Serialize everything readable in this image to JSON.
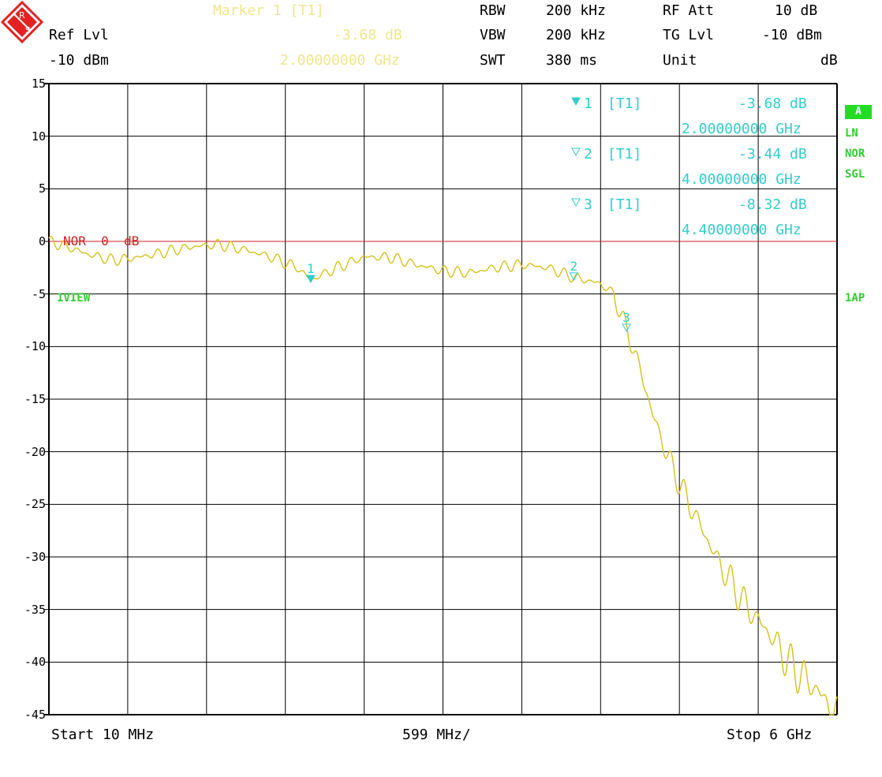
{
  "header": {
    "marker_title": "Marker 1 [T1]",
    "ref_lvl_label": "Ref Lvl",
    "ref_lvl_value": "-10 dBm",
    "marker_level": "-3.68 dB",
    "marker_freq": "2.00000000 GHz",
    "rbw_label": "RBW",
    "rbw_value": "200 kHz",
    "vbw_label": "VBW",
    "vbw_value": "200 kHz",
    "swt_label": "SWT",
    "swt_value": "380 ms",
    "rf_att_label": "RF Att",
    "rf_att_value": "10 dB",
    "tg_lvl_label": "TG Lvl",
    "tg_lvl_value": "-10 dBm",
    "unit_label": "Unit",
    "unit_value": "dB"
  },
  "markers": [
    {
      "label": "1",
      "tag": "[T1]",
      "level": "-3.68 dB",
      "freq": "2.00000000 GHz"
    },
    {
      "label": "2",
      "tag": "[T1]",
      "level": "-3.44 dB",
      "freq": "4.00000000 GHz"
    },
    {
      "label": "3",
      "tag": "[T1]",
      "level": "-8.32 dB",
      "freq": "4.40000000 GHz"
    }
  ],
  "side_labels": {
    "a": "A",
    "ln": "LN",
    "nor": "NOR",
    "sgl": "SGL",
    "ap": "1AP",
    "view": "1VIEW"
  },
  "ref_line_label": "NOR  0  dB",
  "footer": {
    "start": "Start 10 MHz",
    "div": "599 MHz/",
    "stop": "Stop 6 GHz"
  },
  "colors": {
    "trace": "#d4c21a",
    "marker": "#33cccc",
    "ref_line": "#cc2222",
    "annotation": "#f0e68c",
    "grid": "#000000"
  },
  "chart_data": {
    "type": "line",
    "xlabel": "",
    "ylabel": "",
    "x_unit": "GHz",
    "y_unit": "dB",
    "xlim": [
      0.01,
      6.0
    ],
    "ylim": [
      -45,
      15
    ],
    "yticks": [
      15,
      10,
      5,
      0,
      -5,
      -10,
      -15,
      -20,
      -25,
      -30,
      -35,
      -40,
      -45
    ],
    "ytick_labels": [
      "15",
      "10",
      "5",
      "0",
      "-5",
      "-10",
      "-15",
      "-20",
      "-25",
      "-30",
      "-35",
      "-40",
      "-45"
    ],
    "reference_line": 0,
    "grid": true,
    "series": [
      {
        "x": [
          0.01,
          0.15,
          0.3,
          0.5,
          0.7,
          0.9,
          1.1,
          1.3,
          1.5,
          1.7,
          1.9,
          2.0,
          2.2,
          2.4,
          2.6,
          2.8,
          3.0,
          3.2,
          3.4,
          3.6,
          3.8,
          4.0,
          4.2,
          4.3,
          4.4,
          4.5,
          4.6,
          4.7,
          4.8,
          4.9,
          5.0,
          5.1,
          5.2,
          5.3,
          5.4,
          5.5,
          5.6,
          5.7,
          5.8,
          5.9,
          6.0
        ],
        "values": [
          0.0,
          -0.5,
          -1.2,
          -1.8,
          -1.5,
          -1.0,
          -0.5,
          -0.3,
          -0.8,
          -1.5,
          -2.5,
          -3.68,
          -2.5,
          -1.5,
          -1.5,
          -2.2,
          -2.8,
          -3.0,
          -2.5,
          -2.2,
          -2.5,
          -3.44,
          -4.0,
          -5.0,
          -8.32,
          -12.0,
          -16.5,
          -20.0,
          -23.0,
          -25.5,
          -28.0,
          -30.5,
          -32.5,
          -34.5,
          -36.0,
          -37.5,
          -39.5,
          -41.0,
          -42.0,
          -43.5,
          -45.0
        ]
      }
    ]
  }
}
